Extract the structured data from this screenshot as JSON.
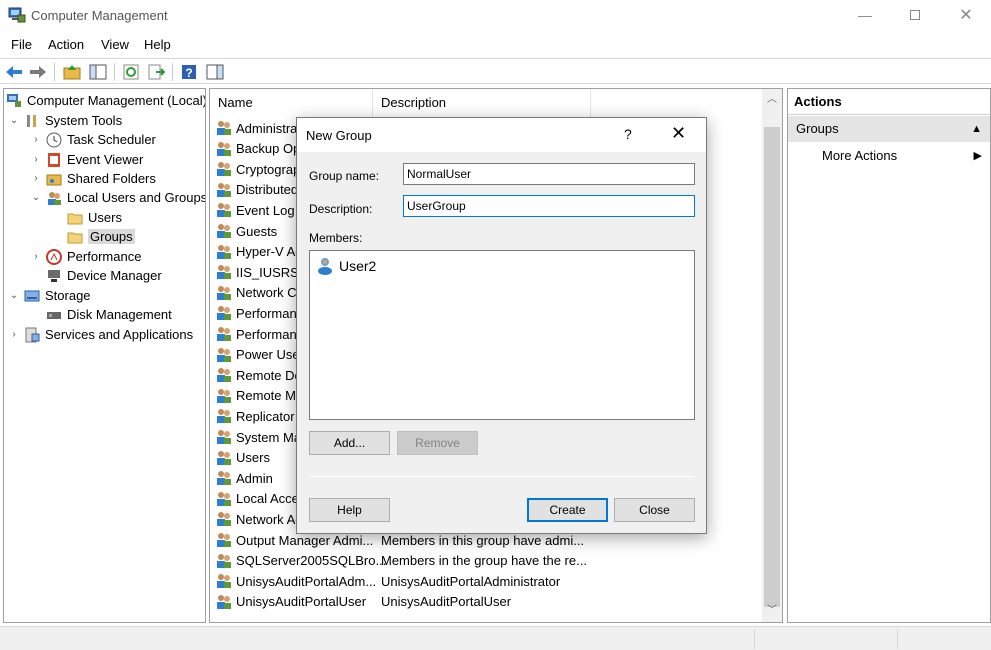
{
  "window": {
    "title": "Computer Management"
  },
  "menu": [
    "File",
    "Action",
    "View",
    "Help"
  ],
  "tree": [
    {
      "label": "Computer Management (Local)",
      "twisty": "",
      "icon": "computer-management-icon"
    },
    {
      "label": "System Tools",
      "twisty": "⌄",
      "icon": "tools-icon"
    },
    {
      "label": "Task Scheduler",
      "twisty": "›",
      "icon": "clock-icon"
    },
    {
      "label": "Event Viewer",
      "twisty": "›",
      "icon": "event-viewer-icon"
    },
    {
      "label": "Shared Folders",
      "twisty": "›",
      "icon": "shared-folder-icon"
    },
    {
      "label": "Local Users and Groups",
      "twisty": "⌄",
      "icon": "users-icon"
    },
    {
      "label": "Users",
      "twisty": "",
      "icon": "folder-icon"
    },
    {
      "label": "Groups",
      "twisty": "",
      "icon": "folder-icon"
    },
    {
      "label": "Performance",
      "twisty": "›",
      "icon": "performance-icon"
    },
    {
      "label": "Device Manager",
      "twisty": "",
      "icon": "device-manager-icon"
    },
    {
      "label": "Storage",
      "twisty": "⌄",
      "icon": "storage-icon"
    },
    {
      "label": "Disk Management",
      "twisty": "",
      "icon": "disk-icon"
    },
    {
      "label": "Services and Applications",
      "twisty": "›",
      "icon": "services-icon"
    }
  ],
  "list": {
    "columns": [
      "Name",
      "Description"
    ],
    "rows": [
      {
        "name": "Administra",
        "desc": ""
      },
      {
        "name": "Backup Op",
        "desc": ""
      },
      {
        "name": "Cryptograp",
        "desc": ""
      },
      {
        "name": "Distributed",
        "desc": ""
      },
      {
        "name": "Event Log R",
        "desc": ""
      },
      {
        "name": "Guests",
        "desc": ""
      },
      {
        "name": "Hyper-V Ad",
        "desc": ""
      },
      {
        "name": "IIS_IUSRS",
        "desc": ""
      },
      {
        "name": "Network Co",
        "desc": ""
      },
      {
        "name": "Performanc",
        "desc": ""
      },
      {
        "name": "Performanc",
        "desc": ""
      },
      {
        "name": "Power User",
        "desc": ""
      },
      {
        "name": "Remote De",
        "desc": ""
      },
      {
        "name": "Remote Ma",
        "desc": ""
      },
      {
        "name": "Replicator",
        "desc": ""
      },
      {
        "name": "System Ma",
        "desc": ""
      },
      {
        "name": "Users",
        "desc": ""
      },
      {
        "name": "Admin",
        "desc": ""
      },
      {
        "name": "Local Acces",
        "desc": ""
      },
      {
        "name": "Network Ac",
        "desc": ""
      },
      {
        "name": "Output Manager Admi...",
        "desc": "Members in this group have admi..."
      },
      {
        "name": "SQLServer2005SQLBro...",
        "desc": "Members in the group have the re..."
      },
      {
        "name": "UnisysAuditPortalAdm...",
        "desc": "UnisysAuditPortalAdministrator"
      },
      {
        "name": "UnisysAuditPortalUser",
        "desc": "UnisysAuditPortalUser"
      }
    ]
  },
  "actions": {
    "header": "Actions",
    "group": "Groups",
    "item": "More Actions"
  },
  "dialog": {
    "title": "New Group",
    "help_glyph": "?",
    "close_glyph": "✕",
    "group_name_label": "Group name:",
    "group_name_value": "NormalUser",
    "description_label": "Description:",
    "description_value": "UserGroup",
    "members_label": "Members:",
    "members": [
      "User2"
    ],
    "add_label": "Add...",
    "remove_label": "Remove",
    "help_label": "Help",
    "create_label": "Create",
    "close_label": "Close"
  },
  "colors": {
    "accent": "#0078d7",
    "selection": "#d9d9d9",
    "dialog_bg": "#f0f0f0"
  }
}
